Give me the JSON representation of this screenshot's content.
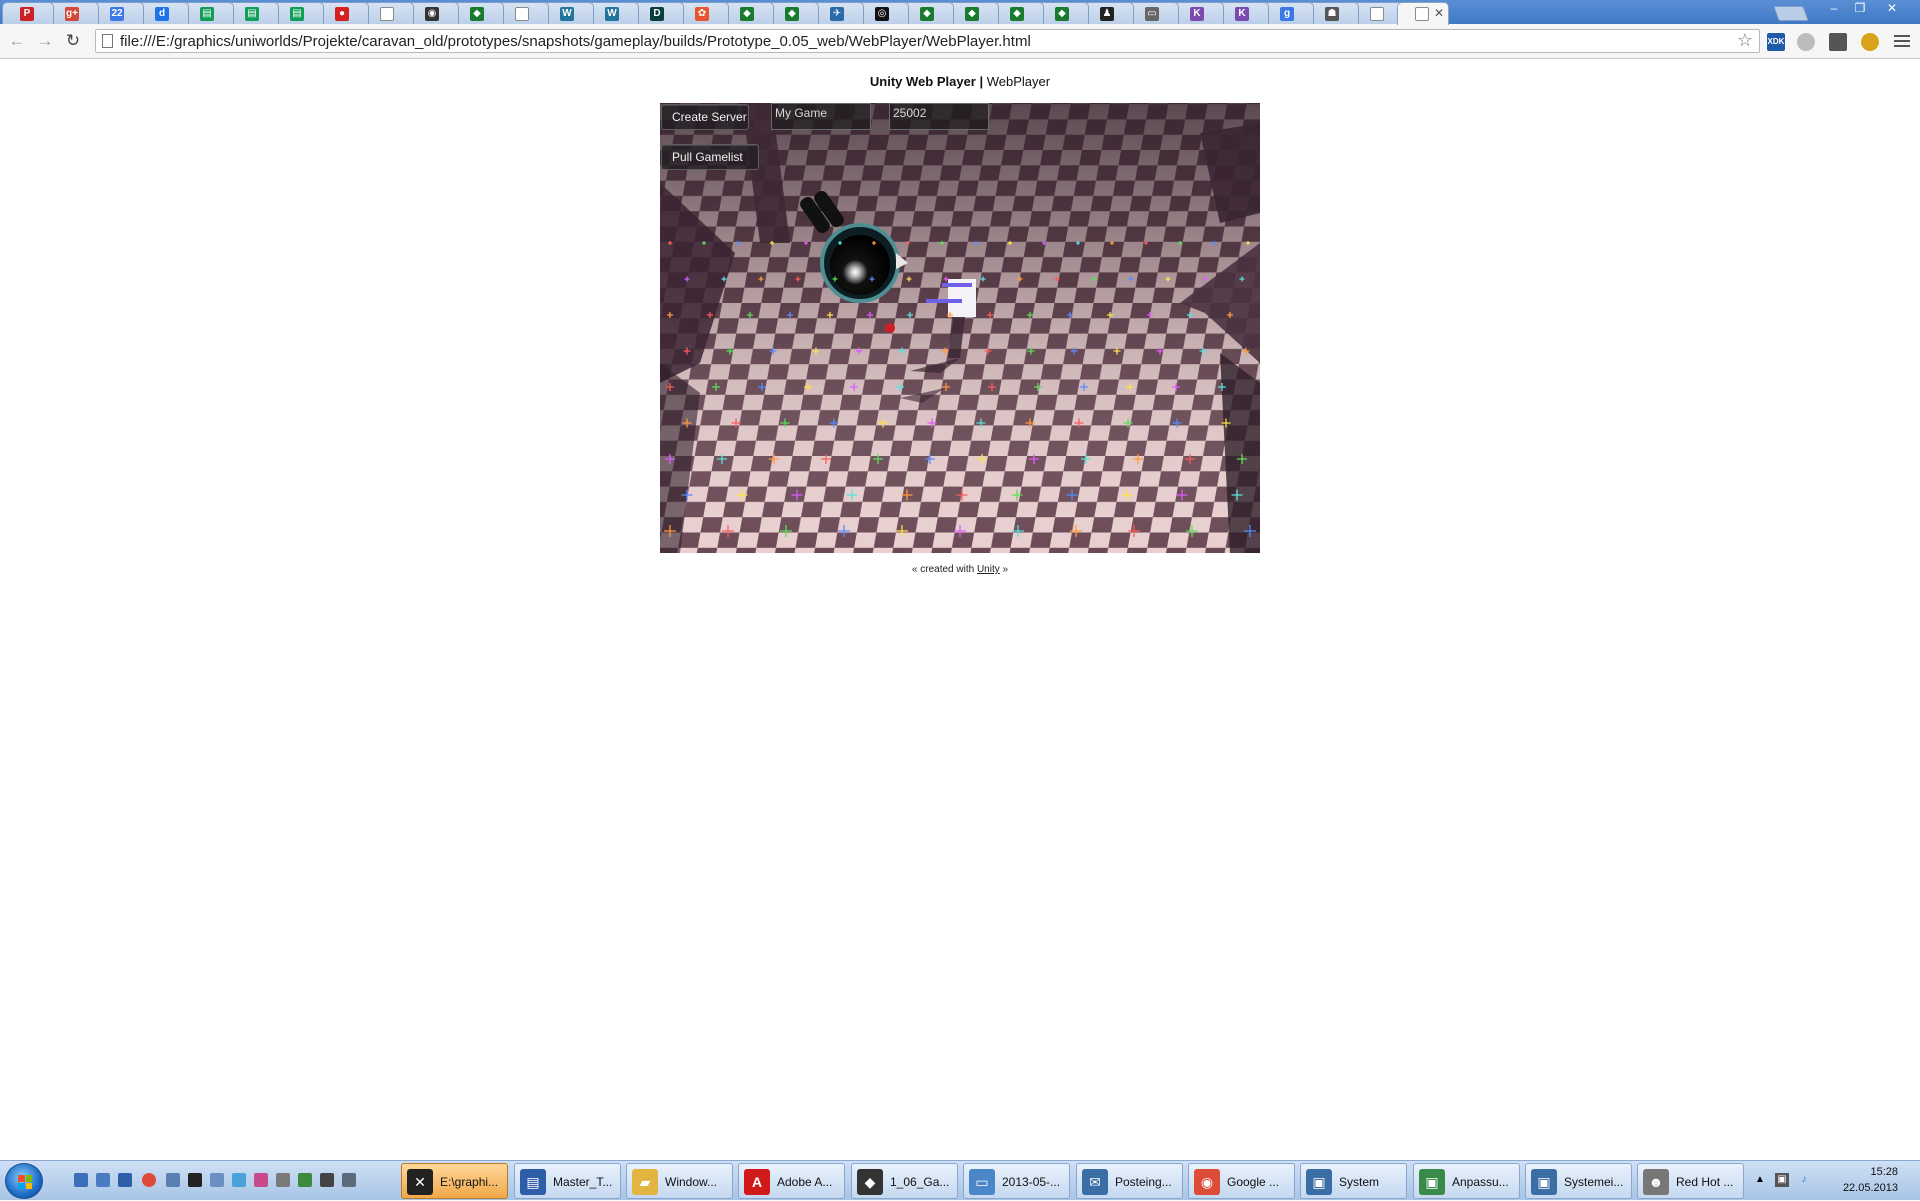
{
  "browser": {
    "url": "file:///E:/graphics/uniworlds/Projekte/caravan_old/prototypes/snapshots/gameplay/builds/Prototype_0.05_web/WebPlayer/WebPlayer.html",
    "tabs": [
      {
        "icon": "pinterest-icon",
        "color": "#cc2127",
        "glyph": "P"
      },
      {
        "icon": "google-plus-icon",
        "color": "#d34836",
        "glyph": "g+"
      },
      {
        "icon": "calendar-icon",
        "color": "#3b78e7",
        "glyph": "22"
      },
      {
        "icon": "d-icon",
        "color": "#1e73e8",
        "glyph": "d"
      },
      {
        "icon": "sheets-icon",
        "color": "#0f9d58",
        "glyph": "▤"
      },
      {
        "icon": "sheets-icon",
        "color": "#0f9d58",
        "glyph": "▤"
      },
      {
        "icon": "sheets-icon",
        "color": "#0f9d58",
        "glyph": "▤"
      },
      {
        "icon": "record-icon",
        "color": "#d61f1f",
        "glyph": "●"
      },
      {
        "icon": "page-icon",
        "color": "#ffffff",
        "glyph": ""
      },
      {
        "icon": "game-icon",
        "color": "#333333",
        "glyph": "◉"
      },
      {
        "icon": "diamond-icon",
        "color": "#1a7a2e",
        "glyph": "◆"
      },
      {
        "icon": "page-icon",
        "color": "#ffffff",
        "glyph": ""
      },
      {
        "icon": "wordpress-icon",
        "color": "#21759b",
        "glyph": "W"
      },
      {
        "icon": "wordpress-icon",
        "color": "#21759b",
        "glyph": "W"
      },
      {
        "icon": "d-icon",
        "color": "#0b3d3d",
        "glyph": "D"
      },
      {
        "icon": "picasa-icon",
        "color": "#e8542d",
        "glyph": "✿"
      },
      {
        "icon": "diamond-icon",
        "color": "#1a7a2e",
        "glyph": "◆"
      },
      {
        "icon": "diamond-icon",
        "color": "#1a7a2e",
        "glyph": "◆"
      },
      {
        "icon": "bird-icon",
        "color": "#2a6aa8",
        "glyph": "✈"
      },
      {
        "icon": "eye-icon",
        "color": "#111111",
        "glyph": "◎"
      },
      {
        "icon": "diamond-icon",
        "color": "#1a7a2e",
        "glyph": "◆"
      },
      {
        "icon": "diamond-icon",
        "color": "#1a7a2e",
        "glyph": "◆"
      },
      {
        "icon": "diamond-icon",
        "color": "#1a7a2e",
        "glyph": "◆"
      },
      {
        "icon": "diamond-icon",
        "color": "#1a7a2e",
        "glyph": "◆"
      },
      {
        "icon": "penguin-icon",
        "color": "#222222",
        "glyph": "♟"
      },
      {
        "icon": "image-icon",
        "color": "#666666",
        "glyph": "▭"
      },
      {
        "icon": "k-icon",
        "color": "#7a4ab0",
        "glyph": "K"
      },
      {
        "icon": "k-icon",
        "color": "#7a4ab0",
        "glyph": "K"
      },
      {
        "icon": "google-icon",
        "color": "#3b78e7",
        "glyph": "g"
      },
      {
        "icon": "helmet-icon",
        "color": "#555555",
        "glyph": "☗"
      },
      {
        "icon": "page-icon",
        "color": "#ffffff",
        "glyph": ""
      },
      {
        "icon": "page-icon",
        "color": "#ffffff",
        "glyph": "",
        "active": true
      }
    ],
    "window_controls": {
      "minimize": "–",
      "restore": "❐",
      "close": "✕"
    }
  },
  "page": {
    "title_bold": "Unity Web Player |",
    "title_rest": "WebPlayer",
    "footer_prefix": "« created with",
    "footer_link": "Unity",
    "footer_suffix": "»"
  },
  "game_ui": {
    "create_server_label": "Create Server",
    "game_name_value": "My Game",
    "port_value": "25002",
    "pull_gamelist_label": "Pull Gamelist"
  },
  "taskbar": {
    "items": [
      {
        "label": "E:\\graphi...",
        "icon": "xnview-icon",
        "color": "#222222",
        "glyph": "✕",
        "active": true
      },
      {
        "label": "Master_T...",
        "icon": "odt-document-icon",
        "color": "#2f5ea8",
        "glyph": "▤"
      },
      {
        "label": "Window...",
        "icon": "folder-icon",
        "color": "#e2b440",
        "glyph": "▰"
      },
      {
        "label": "Adobe A...",
        "icon": "adobe-reader-icon",
        "color": "#d11b1b",
        "glyph": "A"
      },
      {
        "label": "1_06_Ga...",
        "icon": "unity-icon",
        "color": "#333333",
        "glyph": "◆"
      },
      {
        "label": "2013-05-...",
        "icon": "image-viewer-icon",
        "color": "#4a86c8",
        "glyph": "▭"
      },
      {
        "label": "Posteing...",
        "icon": "thunderbird-icon",
        "color": "#3a6ea5",
        "glyph": "✉"
      },
      {
        "label": "Google ...",
        "icon": "chrome-icon",
        "color": "#dd4b39",
        "glyph": "◉"
      },
      {
        "label": "System",
        "icon": "system-icon",
        "color": "#3a6ea5",
        "glyph": "▣"
      },
      {
        "label": "Anpassu...",
        "icon": "personalize-icon",
        "color": "#3a8a4a",
        "glyph": "▣"
      },
      {
        "label": "Systemei...",
        "icon": "system-icon",
        "color": "#3a6ea5",
        "glyph": "▣"
      },
      {
        "label": "Red Hot ...",
        "icon": "alien-icon",
        "color": "#777777",
        "glyph": "☻"
      }
    ],
    "time": "15:28",
    "date": "22.05.2013"
  }
}
